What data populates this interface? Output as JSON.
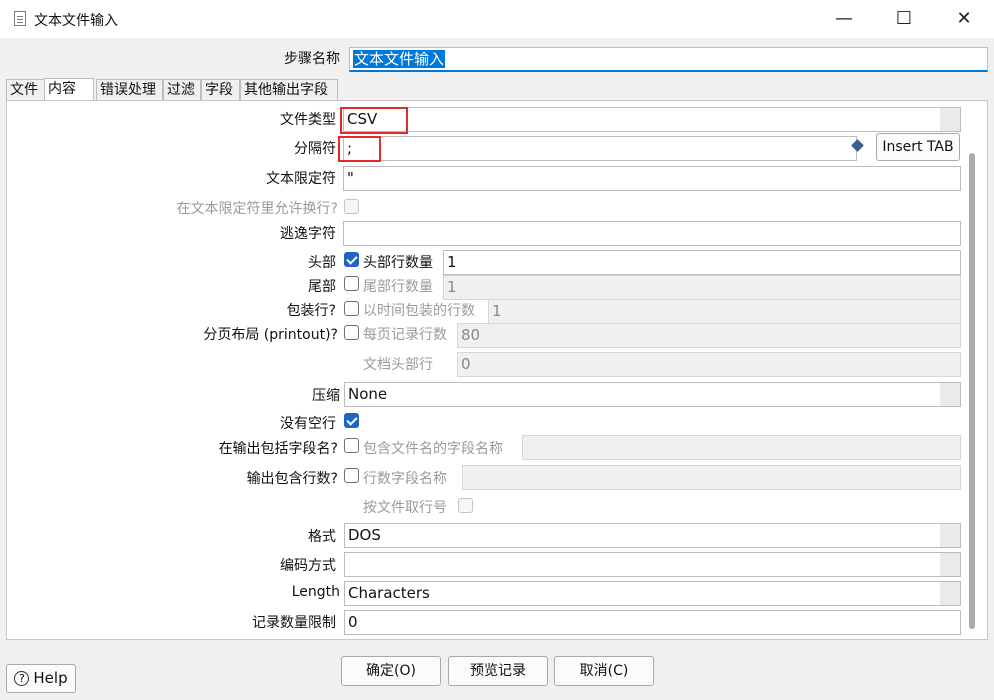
{
  "window": {
    "title": "文本文件输入",
    "minimize_glyph": "—",
    "maximize_glyph": "☐",
    "close_glyph": "✕"
  },
  "step_name": {
    "label": "步骤名称",
    "value": "文本文件输入"
  },
  "tabs": [
    {
      "label": "文件"
    },
    {
      "label": "内容"
    },
    {
      "label": "错误处理"
    },
    {
      "label": "过滤"
    },
    {
      "label": "字段"
    },
    {
      "label": "其他输出字段"
    }
  ],
  "content": {
    "file_type": {
      "label": "文件类型",
      "value": "CSV"
    },
    "separator": {
      "label": "分隔符",
      "value": ";",
      "insert_tab_label": "Insert TAB"
    },
    "enclosure": {
      "label": "文本限定符",
      "value": "\""
    },
    "allow_breaks": {
      "label": "在文本限定符里允许换行?"
    },
    "escape": {
      "label": "逃逸字符",
      "value": ""
    },
    "header": {
      "label": "头部",
      "checked": true,
      "lines_label": "头部行数量",
      "lines_value": "1"
    },
    "footer": {
      "label": "尾部",
      "checked": false,
      "lines_label": "尾部行数量",
      "lines_value": "1"
    },
    "wrapped": {
      "label": "包装行?",
      "checked": false,
      "lines_label": "以时间包装的行数",
      "lines_value": "1"
    },
    "paged": {
      "label": "分页布局 (printout)?",
      "checked": false,
      "lines_label": "每页记录行数",
      "lines_value": "80",
      "doc_header_label": "文档头部行",
      "doc_header_value": "0"
    },
    "compression": {
      "label": "压缩",
      "value": "None"
    },
    "no_empty_rows": {
      "label": "没有空行",
      "checked": true
    },
    "include_filename": {
      "label": "在输出包括字段名?",
      "checked": false,
      "field_label": "包含文件名的字段名称",
      "field_value": ""
    },
    "include_rownum": {
      "label": "输出包含行数?",
      "checked": false,
      "field_label": "行数字段名称",
      "field_value": "",
      "by_file_label": "按文件取行号"
    },
    "format": {
      "label": "格式",
      "value": "DOS"
    },
    "encoding": {
      "label": "编码方式",
      "value": ""
    },
    "length": {
      "label": "Length",
      "value": "Characters"
    },
    "limit": {
      "label": "记录数量限制",
      "value": "0"
    }
  },
  "footer": {
    "help_label": "Help",
    "ok_label": "确定(O)",
    "preview_label": "预览记录",
    "cancel_label": "取消(C)"
  },
  "colors": {
    "highlight": "#e22b2b",
    "selection": "#0078d7",
    "checkbox": "#1f66c4"
  }
}
